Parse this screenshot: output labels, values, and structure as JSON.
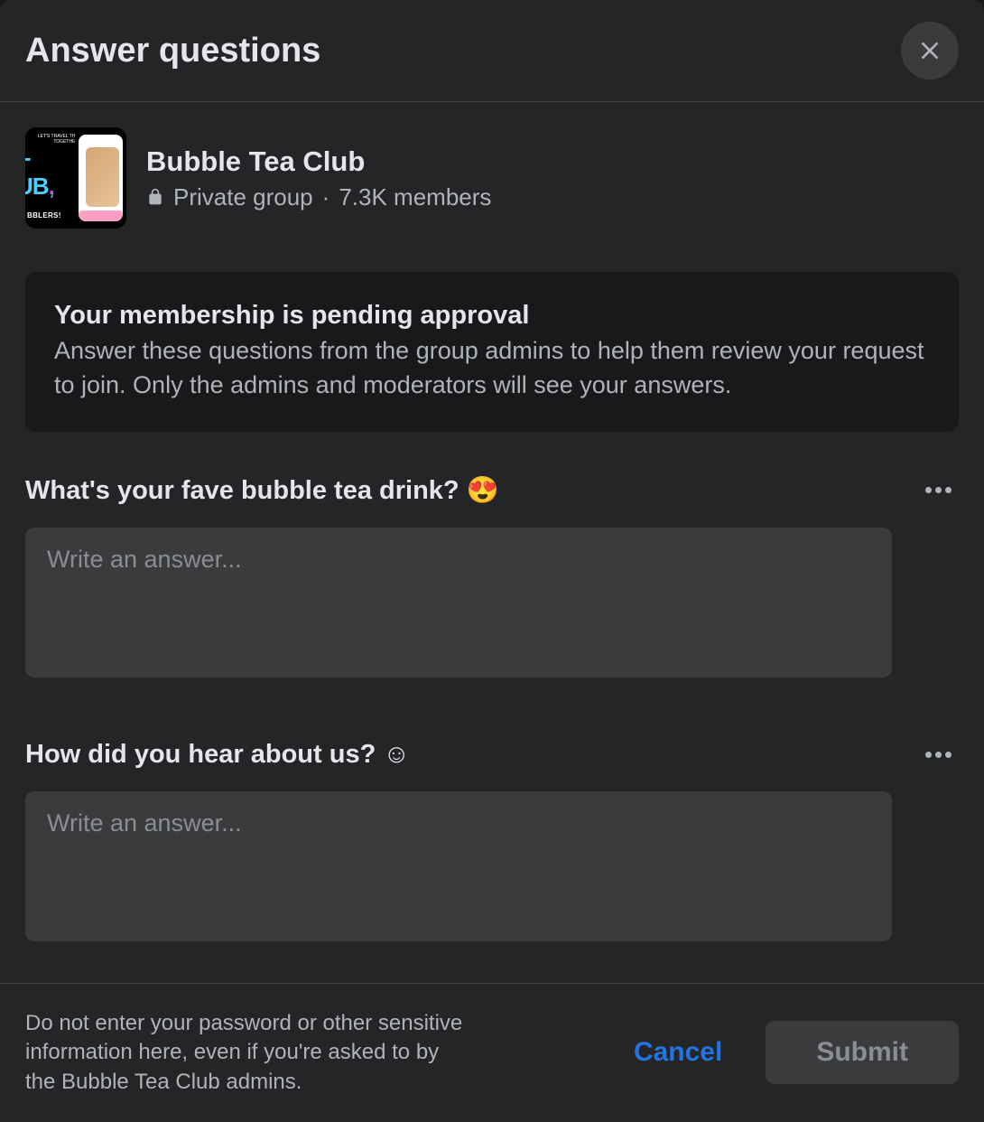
{
  "header": {
    "title": "Answer questions"
  },
  "group": {
    "name": "Bubble Tea Club",
    "privacy": "Private group",
    "members": "7.3K members",
    "separator": " · "
  },
  "pending": {
    "title": "Your membership is pending approval",
    "description": "Answer these questions from the group admins to help them review your request to join. Only the admins and moderators will see your answers."
  },
  "questions": [
    {
      "text": "What's your fave bubble tea drink? 😍",
      "placeholder": "Write an answer..."
    },
    {
      "text": "How did you hear about us? ☺",
      "placeholder": "Write an answer..."
    }
  ],
  "footer": {
    "warning": "Do not enter your password or other sensitive information here, even if you're asked to by the Bubble Tea Club admins.",
    "cancel": "Cancel",
    "submit": "Submit"
  }
}
